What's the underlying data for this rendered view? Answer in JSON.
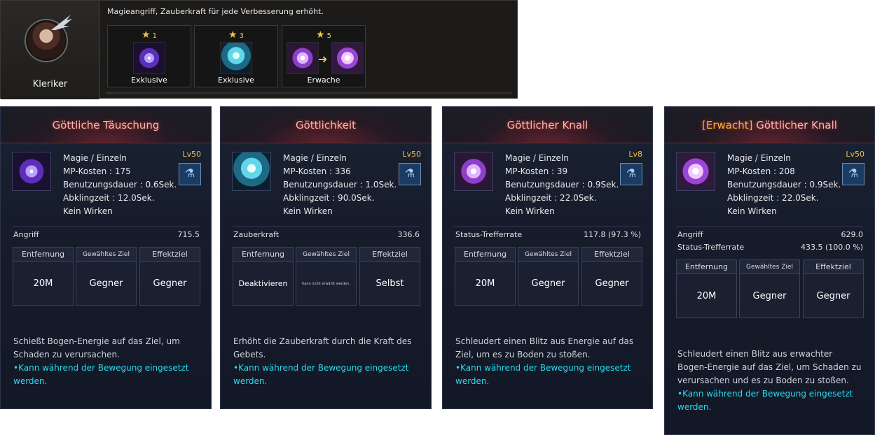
{
  "top": {
    "class_name": "Kleriker",
    "description": "Magieangriff, Zauberkraft für jede Verbesserung erhöht.",
    "slots": [
      {
        "star": "1",
        "label": "Exklusive",
        "icon": "purple-orb-icon"
      },
      {
        "star": "3",
        "label": "Exklusive",
        "icon": "cyan-figure-icon"
      },
      {
        "star": "5",
        "label": "Erwache",
        "icon": "burst-icon"
      }
    ]
  },
  "cards": [
    {
      "title": "Göttliche Täuschung",
      "level": "Lv50",
      "stats": [
        "Magie / Einzeln",
        "MP-Kosten : 175",
        "Benutzungsdauer : 0.6Sek.",
        "Abklingzeit : 12.0Sek.",
        "Kein Wirken"
      ],
      "attrs": [
        {
          "name": "Angriff",
          "value": "715.5"
        }
      ],
      "targets": [
        {
          "head": "Entfernung",
          "value": "20M"
        },
        {
          "head": "Gewähltes Ziel",
          "value": "Gegner"
        },
        {
          "head": "Effektziel",
          "value": "Gegner"
        }
      ],
      "desc": "Schießt Bogen-Energie auf das Ziel, um Schaden zu verursachen.",
      "note": "•Kann während der Bewegung eingesetzt werden."
    },
    {
      "title": "Göttlichkeit",
      "level": "Lv50",
      "stats": [
        "Magie / Einzeln",
        "MP-Kosten : 336",
        "Benutzungsdauer : 1.0Sek.",
        "Abklingzeit : 90.0Sek.",
        "Kein Wirken"
      ],
      "attrs": [
        {
          "name": "Zauberkraft",
          "value": "336.6"
        }
      ],
      "targets": [
        {
          "head": "Entfernung",
          "value": "Deaktivieren"
        },
        {
          "head": "Gewähltes Ziel",
          "value": "Kann nicht erwählt werden."
        },
        {
          "head": "Effektziel",
          "value": "Selbst"
        }
      ],
      "desc": "Erhöht die Zauberkraft durch die Kraft des Gebets.",
      "note": "•Kann während der Bewegung eingesetzt werden."
    },
    {
      "title": "Göttlicher Knall",
      "level": "Lv8",
      "stats": [
        "Magie / Einzeln",
        "MP-Kosten : 39",
        "Benutzungsdauer : 0.9Sek.",
        "Abklingzeit : 22.0Sek.",
        "Kein Wirken"
      ],
      "attrs": [
        {
          "name": "Status-Trefferrate",
          "value": "117.8 (97.3 %)"
        }
      ],
      "targets": [
        {
          "head": "Entfernung",
          "value": "20M"
        },
        {
          "head": "Gewähltes Ziel",
          "value": "Gegner"
        },
        {
          "head": "Effektziel",
          "value": "Gegner"
        }
      ],
      "desc": "Schleudert einen Blitz aus Energie auf das Ziel, um es zu Boden zu stoßen.",
      "note": "•Kann während der Bewegung eingesetzt werden."
    },
    {
      "title_prefix": "[Erwacht]",
      "title": " Göttlicher Knall",
      "level": "Lv50",
      "stats": [
        "Magie / Einzeln",
        "MP-Kosten : 208",
        "Benutzungsdauer : 0.9Sek.",
        "Abklingzeit : 22.0Sek.",
        "Kein Wirken"
      ],
      "attrs": [
        {
          "name": "Angriff",
          "value": "629.0"
        },
        {
          "name": "Status-Trefferrate",
          "value": "433.5 (100.0 %)"
        }
      ],
      "targets": [
        {
          "head": "Entfernung",
          "value": "20M"
        },
        {
          "head": "Gewähltes Ziel",
          "value": "Gegner"
        },
        {
          "head": "Effektziel",
          "value": "Gegner"
        }
      ],
      "desc": "Schleudert einen Blitz aus erwachter Bogen-Energie auf das Ziel, um Schaden zu verursachen und es zu Boden zu stoßen.",
      "note": "•Kann während der Bewegung eingesetzt werden."
    }
  ]
}
